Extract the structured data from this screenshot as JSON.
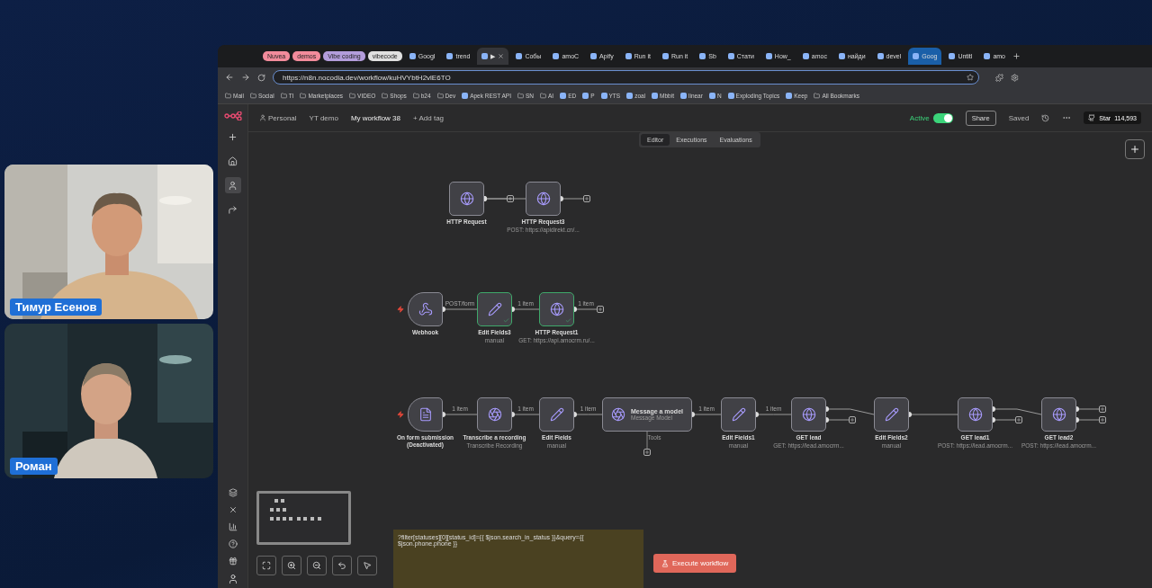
{
  "participants": [
    {
      "name": "Тимур Есенов",
      "kind": "picture"
    },
    {
      "name": "Роман",
      "kind": "picture"
    }
  ],
  "browser": {
    "tab_groups": [
      {
        "label": "Nuvea",
        "color": "#f28b9b"
      },
      {
        "label": "demos",
        "color": "#f28b9b"
      },
      {
        "label": "Vibe coding",
        "color": "#b39ddb"
      },
      {
        "label": "vibecode",
        "color": "#e0e0e0"
      }
    ],
    "tabs": [
      {
        "title": "Googl",
        "selected": false
      },
      {
        "title": "trend",
        "selected": false
      },
      {
        "title": "▶",
        "selected": true
      },
      {
        "title": "Собы",
        "selected": false
      },
      {
        "title": "amoC",
        "selected": false
      },
      {
        "title": "Apify",
        "selected": false
      },
      {
        "title": "Run it",
        "selected": false
      },
      {
        "title": "Run it",
        "selected": false
      },
      {
        "title": "Sb",
        "selected": false
      },
      {
        "title": "Стати",
        "selected": false
      },
      {
        "title": "How_",
        "selected": false
      },
      {
        "title": "amoc",
        "selected": false
      },
      {
        "title": "найди",
        "selected": false
      },
      {
        "title": "devel",
        "selected": false
      },
      {
        "title": "Goog",
        "selected": false,
        "hovered": true
      },
      {
        "title": "Untitl",
        "selected": false
      },
      {
        "title": "amo",
        "selected": false
      }
    ],
    "url": "https://n8n.nocodia.dev/workflow/kuHVYbtH2vlE6TO",
    "bookmarks": [
      {
        "label": "Mail",
        "kind": "folder"
      },
      {
        "label": "Social",
        "kind": "folder"
      },
      {
        "label": "TI",
        "kind": "folder"
      },
      {
        "label": "Marketplaces",
        "kind": "folder"
      },
      {
        "label": "VIDEO",
        "kind": "folder"
      },
      {
        "label": "Shops",
        "kind": "folder"
      },
      {
        "label": "b24",
        "kind": "folder"
      },
      {
        "label": "Dev",
        "kind": "folder"
      },
      {
        "label": "Apek REST API",
        "kind": "page"
      },
      {
        "label": "SN",
        "kind": "folder"
      },
      {
        "label": "AI",
        "kind": "folder"
      },
      {
        "label": "ED",
        "kind": "page"
      },
      {
        "label": "P",
        "kind": "page"
      },
      {
        "label": "YTS",
        "kind": "page"
      },
      {
        "label": "zoal",
        "kind": "page"
      },
      {
        "label": "Mbbit",
        "kind": "page"
      },
      {
        "label": "linear",
        "kind": "page"
      },
      {
        "label": "N",
        "kind": "page"
      },
      {
        "label": "Exploding Topics",
        "kind": "page"
      },
      {
        "label": "Keep",
        "kind": "page"
      },
      {
        "label": "All Bookmarks",
        "kind": "folder"
      }
    ]
  },
  "app": {
    "breadcrumbs": [
      "Personal",
      "YT demo",
      "My workflow 38"
    ],
    "add_tag": "+ Add tag",
    "active": {
      "label": "Active",
      "on": true
    },
    "share": "Share",
    "saved": "Saved",
    "star": {
      "label": "Star",
      "count": "114,593"
    },
    "view_tabs": [
      {
        "label": "Editor",
        "selected": true
      },
      {
        "label": "Executions",
        "selected": false
      },
      {
        "label": "Evaluations",
        "selected": false
      }
    ],
    "sidebar_top": [
      {
        "kind": "add",
        "selected": false
      },
      {
        "kind": "home",
        "selected": false
      },
      {
        "kind": "user",
        "selected": true
      },
      {
        "kind": "share",
        "selected": false
      }
    ],
    "sidebar_bottom": [
      {
        "kind": "templates"
      },
      {
        "kind": "variables"
      },
      {
        "kind": "insights"
      },
      {
        "kind": "help"
      },
      {
        "kind": "updates"
      }
    ],
    "rows": [
      {
        "trigger": false,
        "nodes": [
          {
            "label": "HTTP Request",
            "kind": "http",
            "success": false,
            "branch": false,
            "end_plus": true
          },
          {
            "label": "HTTP Request3",
            "subtitle": "POST: https://apidirekt.cn/...",
            "kind": "http",
            "success": false,
            "branch": false,
            "end_plus": true
          }
        ]
      },
      {
        "trigger": true,
        "nodes": [
          {
            "label": "Webhook",
            "kind": "webhook",
            "success": false,
            "branch": false,
            "out_label": "POST/form",
            "end_plus": false
          },
          {
            "label": "Edit Fields3",
            "subtitle": "manual",
            "kind": "edit",
            "success": true,
            "branch": false,
            "out_label": "1 item",
            "end_plus": false
          },
          {
            "label": "HTTP Request1",
            "subtitle": "GET: https://api.amocrm.ru/...",
            "kind": "http",
            "success": true,
            "branch": false,
            "out_label": "1 item",
            "end_plus": true
          }
        ]
      },
      {
        "trigger": true,
        "nodes": [
          {
            "label": "On form submission (Deactivated)",
            "kind": "form",
            "success": false,
            "branch": false,
            "out_label": "1 item",
            "end_plus": false
          },
          {
            "label": "Transcribe a recording",
            "subtitle": "Transcribe Recording",
            "kind": "openai",
            "success": false,
            "branch": false,
            "out_label": "1 item",
            "end_plus": false
          },
          {
            "label": "Edit Fields",
            "subtitle": "manual",
            "kind": "edit",
            "success": false,
            "branch": false,
            "out_label": "1 item",
            "end_plus": false
          },
          {
            "label": "Message a model",
            "subtitle": "Message Model",
            "kind": "openai",
            "success": false,
            "branch": false,
            "out_label": "1 item",
            "end_plus": false,
            "tool_label": "Tools"
          },
          {
            "label": "Edit Fields1",
            "subtitle": "manual",
            "kind": "edit",
            "success": false,
            "branch": false,
            "out_label": "1 item",
            "end_plus": false
          },
          {
            "label": "GET lead",
            "subtitle": "GET: https://lead.amocrm...",
            "kind": "http",
            "success": false,
            "branch": true,
            "end_plus": false
          },
          {
            "label": "Edit Fields2",
            "subtitle": "manual",
            "kind": "edit",
            "success": false,
            "branch": false,
            "end_plus": false
          },
          {
            "label": "GET lead1",
            "subtitle": "POST: https://lead.amocrm...",
            "kind": "http",
            "success": false,
            "branch": true,
            "end_plus": false
          },
          {
            "label": "GET lead2",
            "subtitle": "POST: https://lead.amocrm...",
            "kind": "http",
            "success": false,
            "branch": true,
            "end_plus": true
          }
        ]
      }
    ],
    "note": "?filter[statuses][0][status_id]={{ $json.search_in_status }}&query={{ $json.phone.phone }}",
    "execute": "Execute workflow"
  }
}
